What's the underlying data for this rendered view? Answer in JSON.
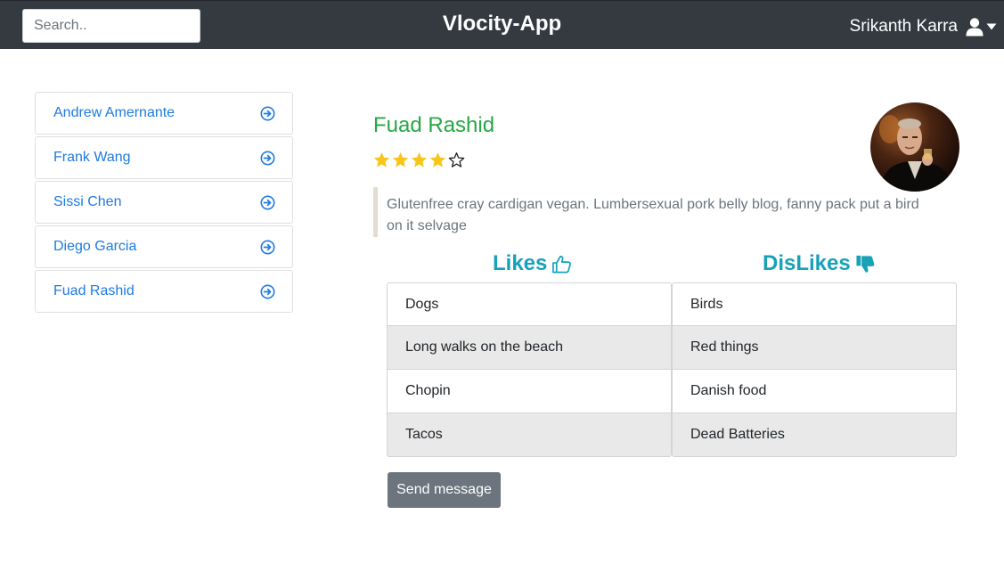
{
  "header": {
    "search_placeholder": "Search..",
    "brand": "Vlocity-App",
    "user_name": "Srikanth Karra"
  },
  "contacts": [
    {
      "name": "Andrew Amernante"
    },
    {
      "name": "Frank Wang"
    },
    {
      "name": "Sissi Chen"
    },
    {
      "name": "Diego Garcia"
    },
    {
      "name": "Fuad Rashid"
    }
  ],
  "profile": {
    "name": "Fuad Rashid",
    "rating": 4,
    "rating_max": 5,
    "bio": "Glutenfree cray cardigan vegan. Lumbersexual pork belly blog, fanny pack put a bird on it selvage",
    "likes_heading": "Likes",
    "dislikes_heading": "DisLikes",
    "likes": [
      "Dogs",
      "Long walks on the beach",
      "Chopin",
      "Tacos"
    ],
    "dislikes": [
      "Birds",
      "Red things",
      "Danish food",
      "Dead Batteries"
    ],
    "send_label": "Send message"
  },
  "icons": {
    "user": "user-icon",
    "caret": "caret-down-icon",
    "list_arrow": "arrow-circle-right-icon",
    "star_filled": "star-filled-icon",
    "star_empty": "star-empty-icon",
    "thumbs_up": "thumbs-up-icon",
    "thumbs_down": "thumbs-down-icon"
  },
  "colors": {
    "navbar": "#343a40",
    "link": "#1e7be0",
    "name": "#28a745",
    "heading": "#17a2b8",
    "star": "#f8c51c",
    "button": "#6c757d"
  }
}
